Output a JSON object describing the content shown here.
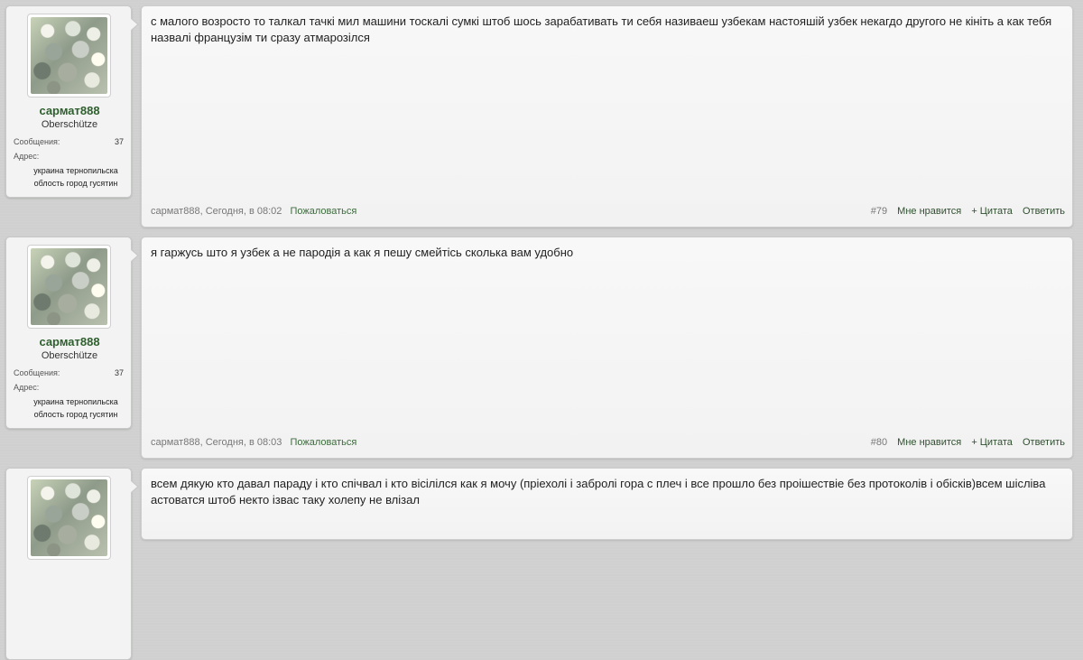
{
  "posts": [
    {
      "user": {
        "name": "сармат888",
        "title": "Oberschütze",
        "messages_label": "Сообщения:",
        "messages_count": "37",
        "address_label": "Адрес:",
        "address": "украина тернопильска облость город гусятин"
      },
      "text": "с малого возросто то талкал тачкі мил машини тоскалі сумкі штоб шось зарабативать ти себя називаеш узбекам настояшій узбек некагдо другого не кініть а как тебя назвалі французім ти сразу атмарозілся",
      "author": "сармат888",
      "time": ", Сегодня, в 08:02",
      "report": "Пожаловаться",
      "number": "#79",
      "like": "Мне нравится",
      "quote": "+ Цитата",
      "reply": "Ответить"
    },
    {
      "user": {
        "name": "сармат888",
        "title": "Oberschütze",
        "messages_label": "Сообщения:",
        "messages_count": "37",
        "address_label": "Адрес:",
        "address": "украина тернопильска облость город гусятин"
      },
      "text": "я гаржусь што я узбек а не пародія а как я пешу смейтісь сколька вам удобно",
      "author": "сармат888",
      "time": ", Сегодня, в 08:03",
      "report": "Пожаловаться",
      "number": "#80",
      "like": "Мне нравится",
      "quote": "+ Цитата",
      "reply": "Ответить"
    },
    {
      "text": "всем дякую кто давал параду і кто спічвал і кто вісілілся как я мочу (пріехолі і забролі гора с плеч і все прошло без проішествіе без протоколів і обісків)всем шісліва астоватся штоб некто ізвас таку холепу не влізал"
    }
  ]
}
